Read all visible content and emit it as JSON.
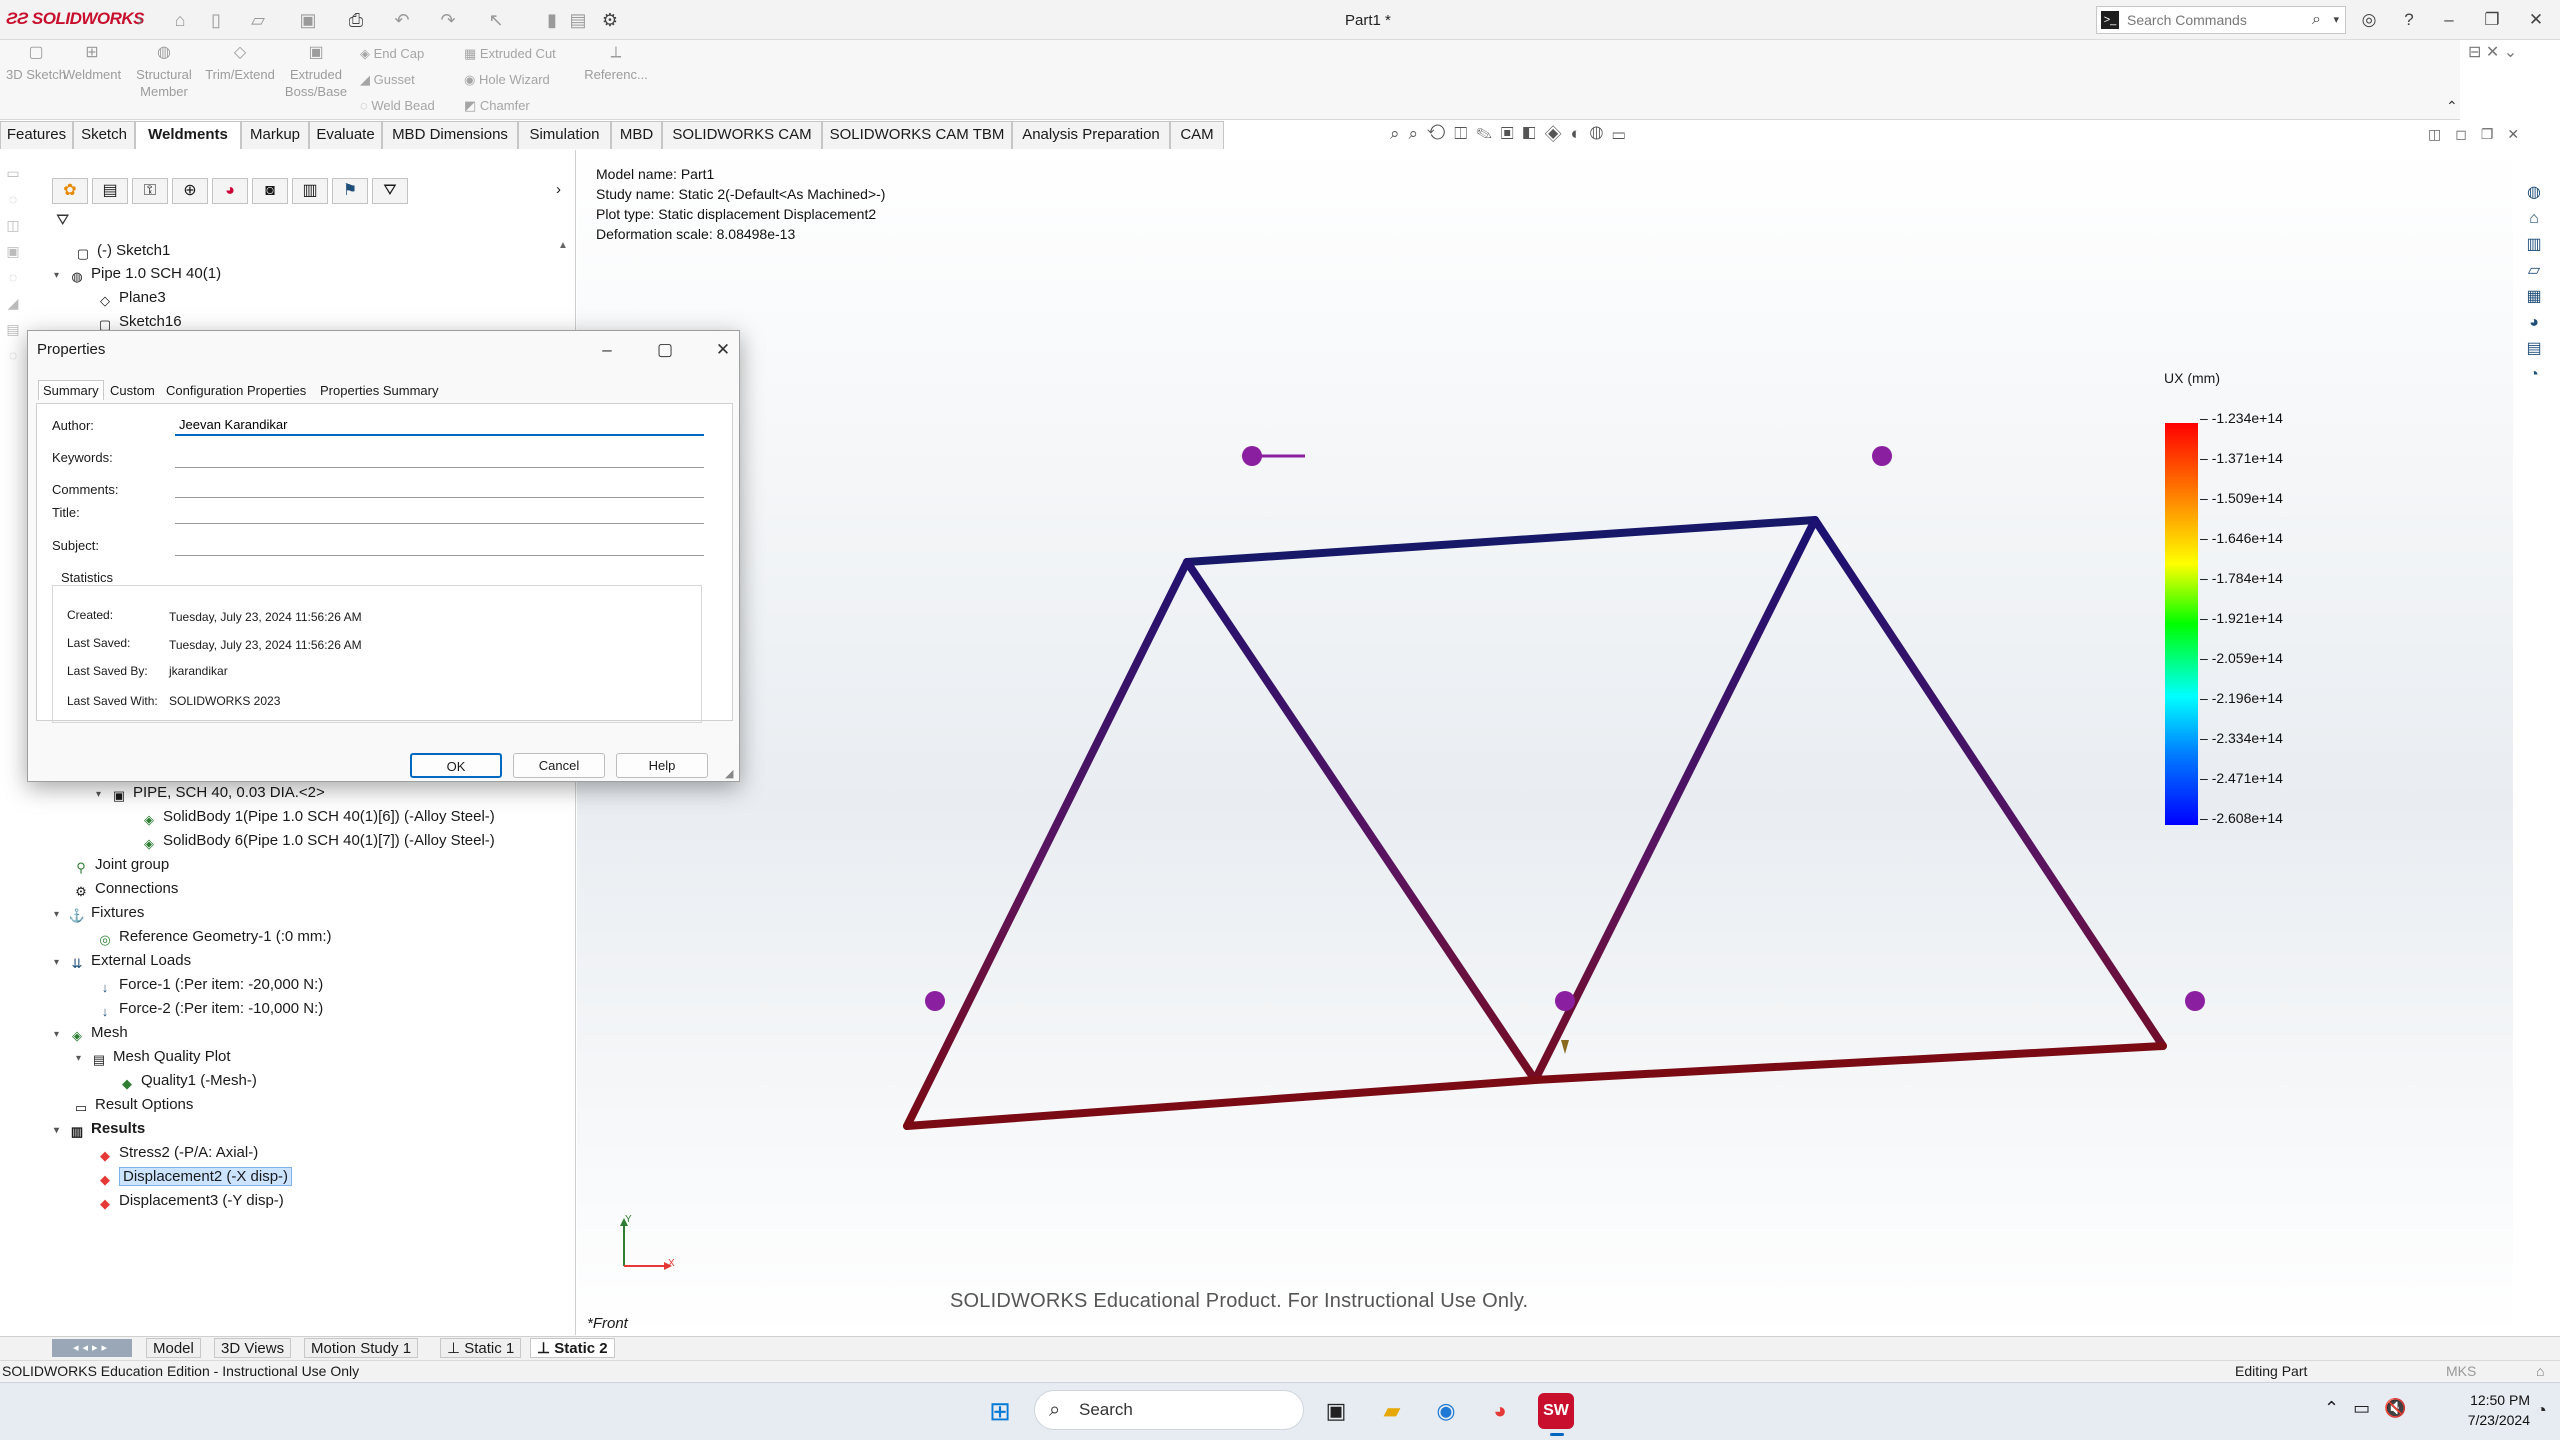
{
  "app": {
    "logo": "SOLIDWORKS",
    "doc_title": "Part1 *"
  },
  "search": {
    "placeholder": "Search Commands"
  },
  "ribbon": {
    "big": [
      "3D Sketch",
      "Weldment",
      "Structural Member",
      "Trim/Extend",
      "Extruded Boss/Base"
    ],
    "small_col1": [
      "End Cap",
      "Gusset",
      "Weld Bead"
    ],
    "small_col2": [
      "Extruded Cut",
      "Hole Wizard",
      "Chamfer"
    ],
    "ref": "Referenc..."
  },
  "tabs": [
    "Features",
    "Sketch",
    "Weldments",
    "Markup",
    "Evaluate",
    "MBD Dimensions",
    "Simulation",
    "MBD",
    "SOLIDWORKS CAM",
    "SOLIDWORKS CAM TBM",
    "Analysis Preparation",
    "CAM"
  ],
  "tree_top": [
    {
      "label": "(-) Sketch1"
    },
    {
      "label": "Pipe 1.0 SCH 40(1)"
    },
    {
      "label": "Plane3"
    },
    {
      "label": "Sketch16"
    }
  ],
  "tree_bottom": [
    {
      "label": "PIPE, SCH 40, 0.03 DIA.<2>"
    },
    {
      "label": "SolidBody 1(Pipe 1.0 SCH 40(1)[6]) (-Alloy Steel-)"
    },
    {
      "label": "SolidBody 6(Pipe 1.0 SCH 40(1)[7]) (-Alloy Steel-)"
    },
    {
      "label": "Joint group"
    },
    {
      "label": "Connections"
    },
    {
      "label": "Fixtures"
    },
    {
      "label": "Reference Geometry-1 (:0 mm:)"
    },
    {
      "label": "External Loads"
    },
    {
      "label": "Force-1 (:Per item: -20,000 N:)"
    },
    {
      "label": "Force-2 (:Per item: -10,000 N:)"
    },
    {
      "label": "Mesh"
    },
    {
      "label": "Mesh Quality Plot"
    },
    {
      "label": "Quality1 (-Mesh-)"
    },
    {
      "label": "Result Options"
    },
    {
      "label": "Results"
    },
    {
      "label": "Stress2 (-P/A: Axial-)"
    },
    {
      "label": "Displacement2 (-X disp-)"
    },
    {
      "label": "Displacement3 (-Y disp-)"
    }
  ],
  "dialog": {
    "title": "Properties",
    "tabs": [
      "Summary",
      "Custom",
      "Configuration Properties",
      "Properties Summary"
    ],
    "fields": {
      "author_label": "Author:",
      "author_value": "Jeevan Karandikar",
      "keywords_label": "Keywords:",
      "comments_label": "Comments:",
      "title_label": "Title:",
      "subject_label": "Subject:"
    },
    "stats_title": "Statistics",
    "stats": [
      {
        "label": "Created:",
        "value": "Tuesday, July 23, 2024 11:56:26 AM"
      },
      {
        "label": "Last Saved:",
        "value": "Tuesday, July 23, 2024 11:56:26 AM"
      },
      {
        "label": "Last Saved By:",
        "value": "jkarandikar"
      },
      {
        "label": "Last Saved With:",
        "value": "SOLIDWORKS 2023"
      }
    ],
    "buttons": {
      "ok": "OK",
      "cancel": "Cancel",
      "help": "Help"
    }
  },
  "viewport": {
    "info": [
      "Model name: Part1",
      "Study name: Static 2(-Default<As Machined>-)",
      "Plot type: Static displacement Displacement2",
      "Deformation scale: 8.08498e-13"
    ],
    "legend_title": "UX (mm)",
    "legend_ticks": [
      "-1.234e+14",
      "-1.371e+14",
      "-1.509e+14",
      "-1.646e+14",
      "-1.784e+14",
      "-1.921e+14",
      "-2.059e+14",
      "-2.196e+14",
      "-2.334e+14",
      "-2.471e+14",
      "-2.608e+14"
    ],
    "legend_colors": {
      "max": "#ff0000",
      "mid": "#00ff00",
      "min": "#0000ff"
    },
    "view_label": "*Front",
    "watermark": "SOLIDWORKS Educational Product. For Instructional Use Only.",
    "triad": {
      "x": "X",
      "y": "Y"
    }
  },
  "bottom_tabs": [
    "Model",
    "3D Views",
    "Motion Study 1",
    "Static 1",
    "Static 2"
  ],
  "status": {
    "left": "SOLIDWORKS Education Edition - Instructional Use Only",
    "editing": "Editing Part",
    "units": "MKS"
  },
  "taskbar": {
    "search": "Search",
    "time": "12:50 PM",
    "date": "7/23/2024"
  }
}
